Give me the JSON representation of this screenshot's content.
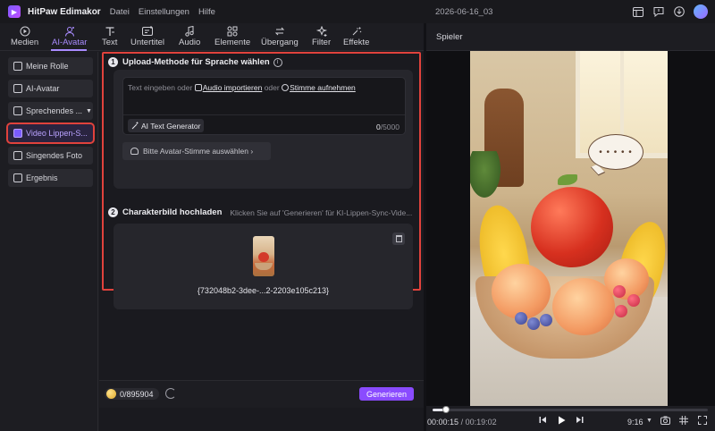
{
  "app": {
    "name": "HitPaw Edimakor",
    "menu": [
      "Datei",
      "Einstellungen",
      "Hilfe"
    ],
    "document_title": "2026-06-16_03"
  },
  "toolbar": {
    "items": [
      {
        "label": "Medien",
        "icon": "media-icon"
      },
      {
        "label": "AI-Avatar",
        "icon": "ai-avatar-icon",
        "active": true
      },
      {
        "label": "Text",
        "icon": "text-icon"
      },
      {
        "label": "Untertitel",
        "icon": "subtitle-icon"
      },
      {
        "label": "Audio",
        "icon": "music-note-icon"
      },
      {
        "label": "Elemente",
        "icon": "elements-icon"
      },
      {
        "label": "Übergang",
        "icon": "transition-icon"
      },
      {
        "label": "Filter",
        "icon": "filter-icon"
      },
      {
        "label": "Effekte",
        "icon": "effects-icon"
      }
    ]
  },
  "sidebar": {
    "items": [
      {
        "label": "Meine Rolle"
      },
      {
        "label": "AI-Avatar"
      },
      {
        "label": "Sprechendes ..."
      },
      {
        "label": "Video Lippen-S...",
        "active": true
      },
      {
        "label": "Singendes Foto"
      },
      {
        "label": "Ergebnis"
      }
    ]
  },
  "section1": {
    "number": "1",
    "title": "Upload-Methode für Sprache wählen",
    "prompt_prefix": "Text eingeben oder",
    "audio_import_link": "Audio importieren",
    "prompt_or": "oder",
    "record_link": "Stimme aufnehmen",
    "ai_text_generator": "AI Text Generator",
    "char_count": "0",
    "char_limit": "/5000",
    "voice_select": "Bitte Avatar-Stimme auswählen ›"
  },
  "section2": {
    "number": "2",
    "title": "Charakterbild hochladen",
    "hint": "Klicken Sie auf 'Generieren' für KI-Lippen-Sync-Vide...",
    "file_name": "{732048b2-3dee-...2-2203e105c213}"
  },
  "footer": {
    "credits": "0/895904",
    "generate_label": "Generieren"
  },
  "player": {
    "title": "Spieler",
    "bubble_text": "• • • • •",
    "current_time": "00:00:15",
    "total_time": "/ 00:19:02",
    "progress": 0.05,
    "aspect_ratio": "9:16"
  },
  "colors": {
    "accent": "#a98bff",
    "generate": "#8a4bff",
    "highlight_box": "#e0423c"
  }
}
